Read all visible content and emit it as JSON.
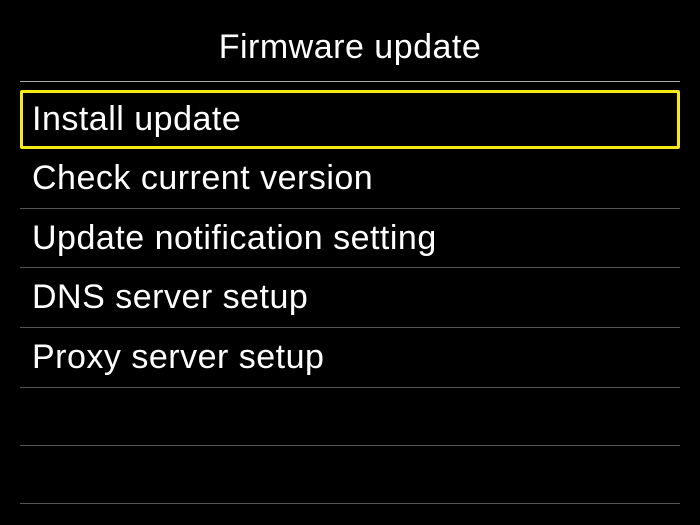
{
  "header": {
    "title": "Firmware update"
  },
  "menu": {
    "items": [
      {
        "label": "Install update",
        "selected": true
      },
      {
        "label": "Check current version",
        "selected": false
      },
      {
        "label": "Update notification setting",
        "selected": false
      },
      {
        "label": "DNS server setup",
        "selected": false
      },
      {
        "label": "Proxy server setup",
        "selected": false
      }
    ]
  }
}
